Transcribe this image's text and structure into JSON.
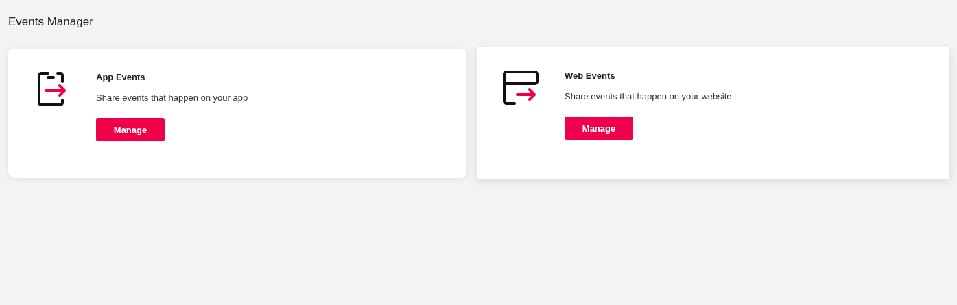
{
  "page": {
    "title": "Events Manager"
  },
  "cards": [
    {
      "kind": "app",
      "title": "App Events",
      "description": "Share events that happen on your app",
      "button": "Manage",
      "highlighted": false
    },
    {
      "kind": "web",
      "title": "Web Events",
      "description": "Share events that happen on your website",
      "button": "Manage",
      "highlighted": true
    }
  ]
}
